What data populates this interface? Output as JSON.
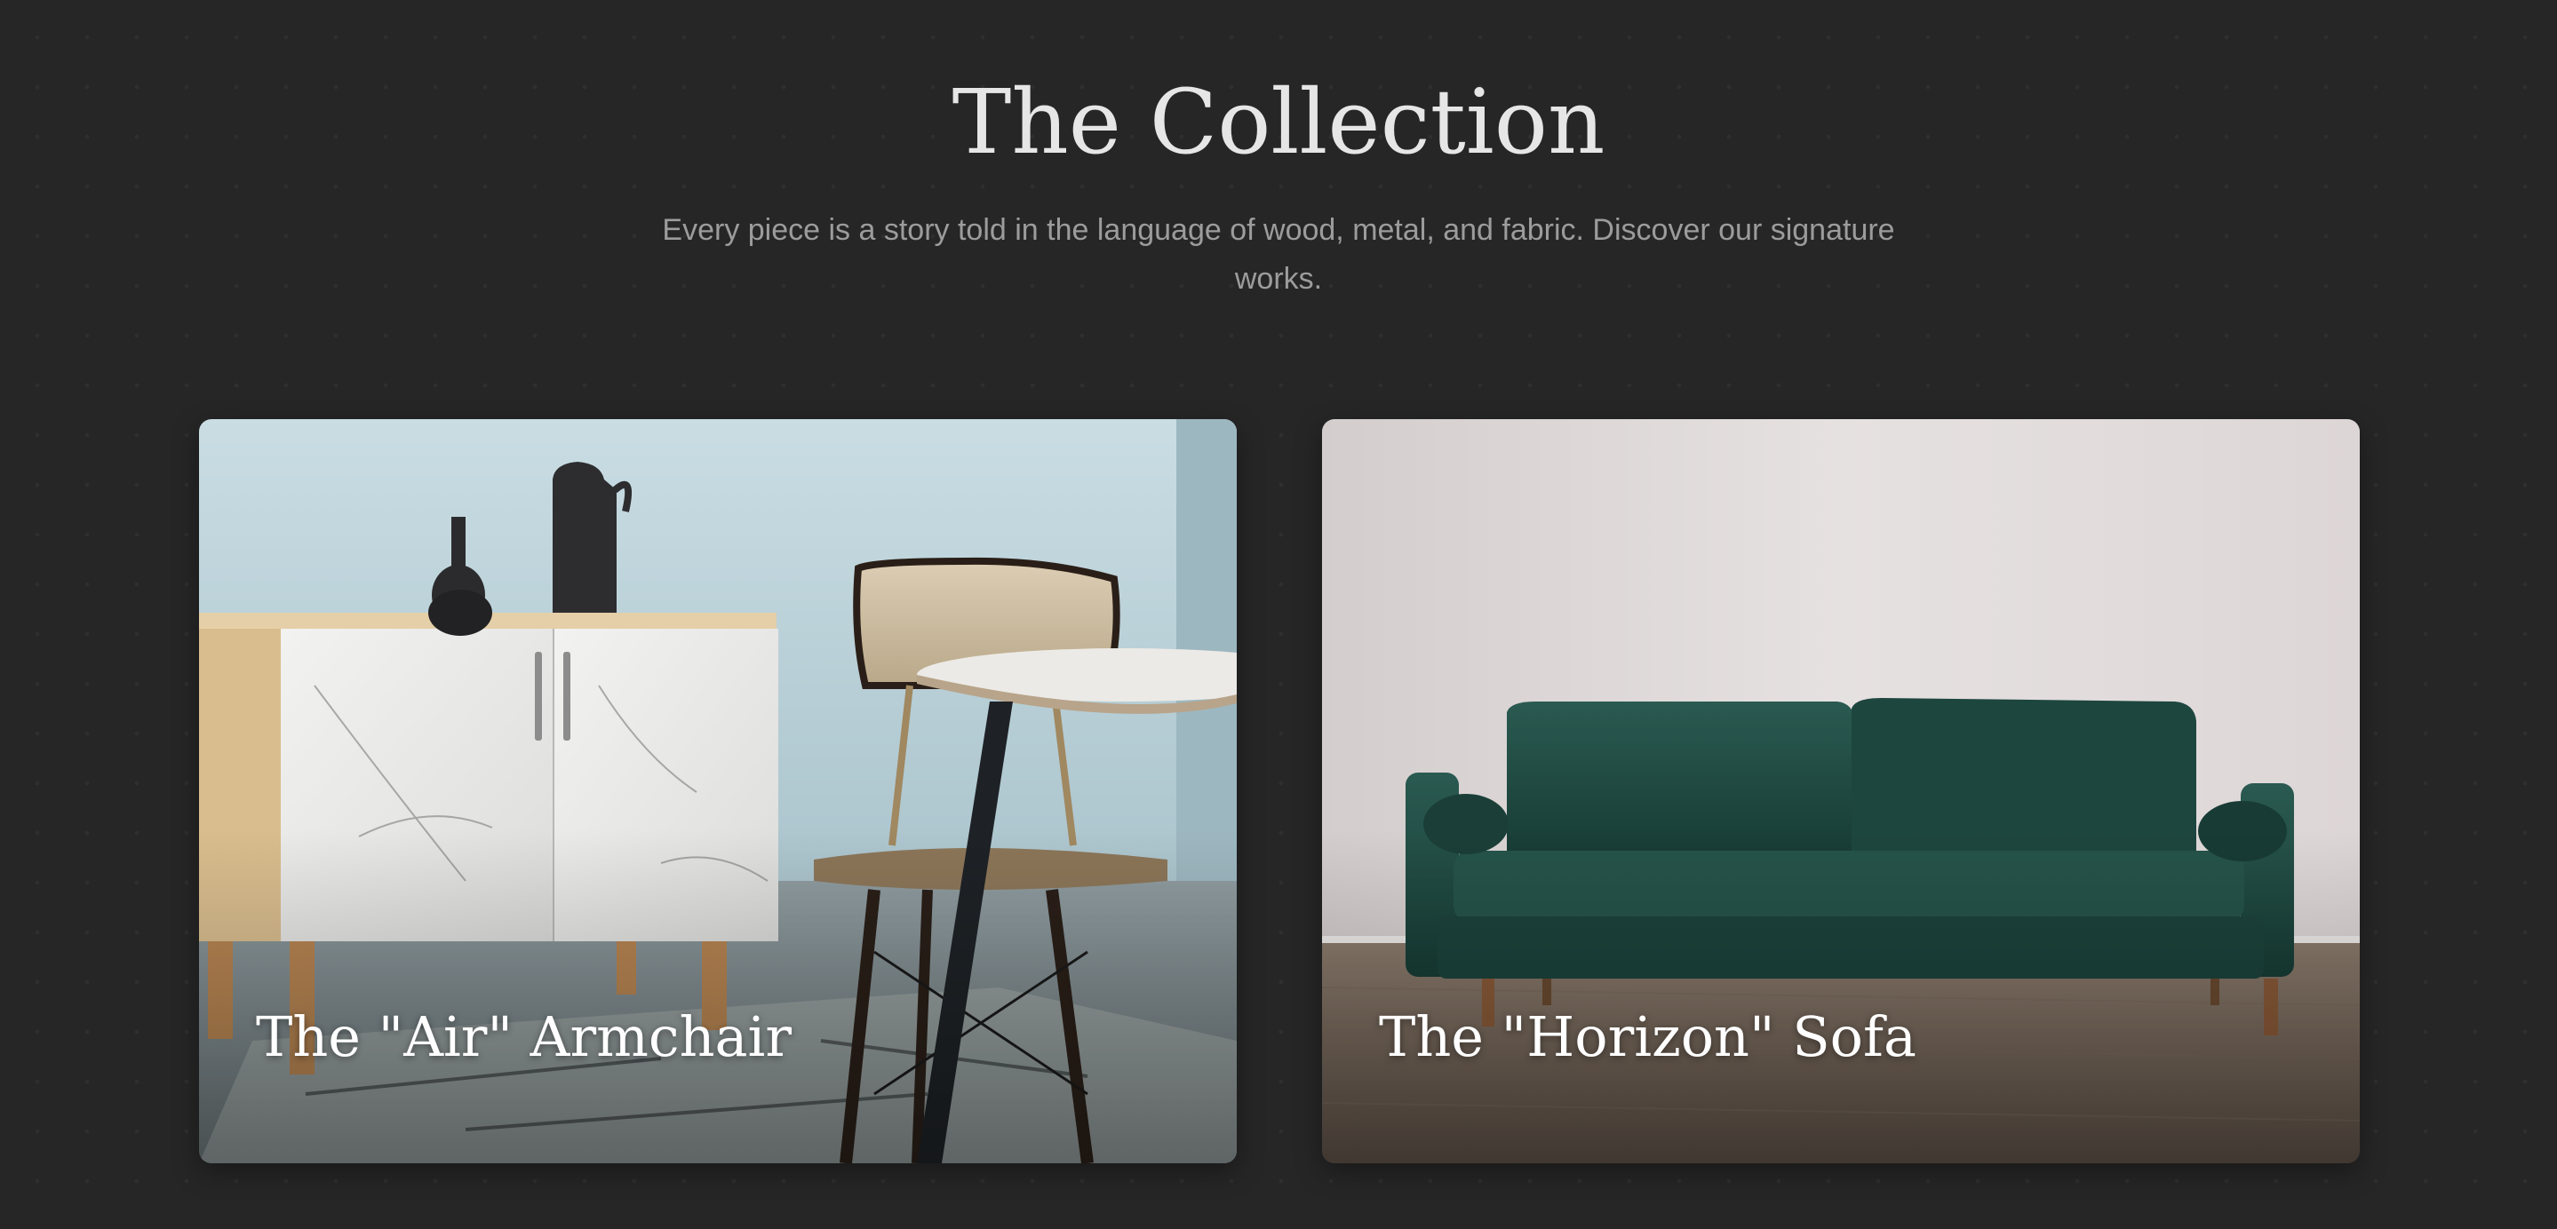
{
  "section": {
    "title": "The Collection",
    "subtitle": "Every piece is a story told in the language of wood, metal, and fabric. Discover our signature works."
  },
  "cards": [
    {
      "label": "The \"Air\" Armchair",
      "image": "dining room with marble sideboard, vases, beige chair and round table"
    },
    {
      "label": "The \"Horizon\" Sofa",
      "image": "green velvet three-seat sofa on wooden floor"
    }
  ],
  "colors": {
    "background": "#262626",
    "title": "#e6e6e6",
    "subtitle": "#9c9c9c",
    "card_label": "#ffffff",
    "sofa_green": "#1f4a42"
  }
}
